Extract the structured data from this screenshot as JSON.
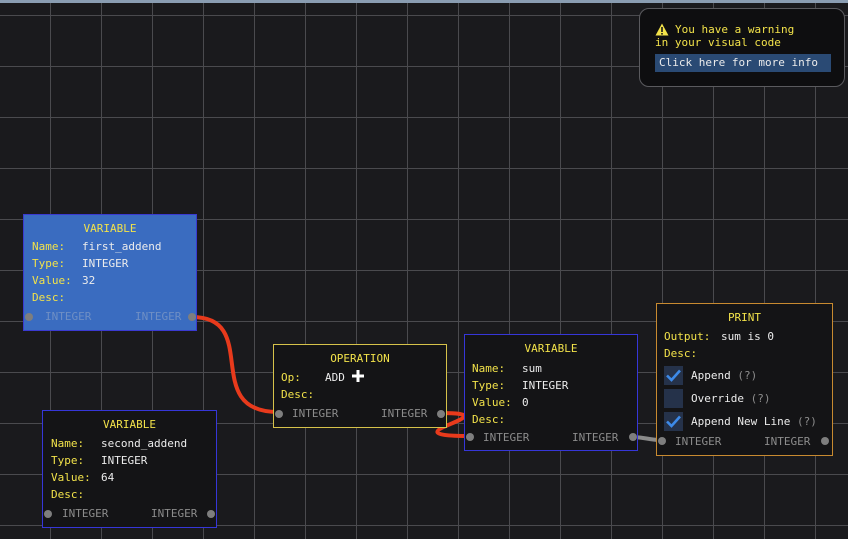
{
  "warning": {
    "line1": "You have a warning",
    "line2": "in your visual code",
    "button_label": "Click here for more info"
  },
  "colors": {
    "label": "#f2e24a",
    "value": "#ececec",
    "wire_active": "#e83a1c",
    "wire_idle": "#8a8a8a",
    "selected_node": "#3a6cc0"
  },
  "nodes": {
    "var1": {
      "title": "VARIABLE",
      "name_label": "Name:",
      "name_value": "first_addend",
      "type_label": "Type:",
      "type_value": "INTEGER",
      "value_label": "Value:",
      "value_value": "32",
      "desc_label": "Desc:",
      "in_pin": "INTEGER",
      "out_pin": "INTEGER"
    },
    "var2": {
      "title": "VARIABLE",
      "name_label": "Name:",
      "name_value": "second_addend",
      "type_label": "Type:",
      "type_value": "INTEGER",
      "value_label": "Value:",
      "value_value": "64",
      "desc_label": "Desc:",
      "in_pin": "INTEGER",
      "out_pin": "INTEGER"
    },
    "op": {
      "title": "OPERATION",
      "op_label": "Op:",
      "op_value": "ADD",
      "op_icon": "plus-icon",
      "desc_label": "Desc:",
      "in_pin": "INTEGER",
      "out_pin": "INTEGER"
    },
    "var3": {
      "title": "VARIABLE",
      "name_label": "Name:",
      "name_value": "sum",
      "type_label": "Type:",
      "type_value": "INTEGER",
      "value_label": "Value:",
      "value_value": "0",
      "desc_label": "Desc:",
      "in_pin": "INTEGER",
      "out_pin": "INTEGER"
    },
    "print": {
      "title": "PRINT",
      "output_label": "Output:",
      "output_value": "sum is 0",
      "desc_label": "Desc:",
      "options": [
        {
          "label": "Append",
          "help": "(?)",
          "checked": true
        },
        {
          "label": "Override",
          "help": "(?)",
          "checked": false
        },
        {
          "label": "Append New Line",
          "help": "(?)",
          "checked": true
        }
      ],
      "in_pin": "INTEGER",
      "out_pin": "INTEGER"
    }
  }
}
